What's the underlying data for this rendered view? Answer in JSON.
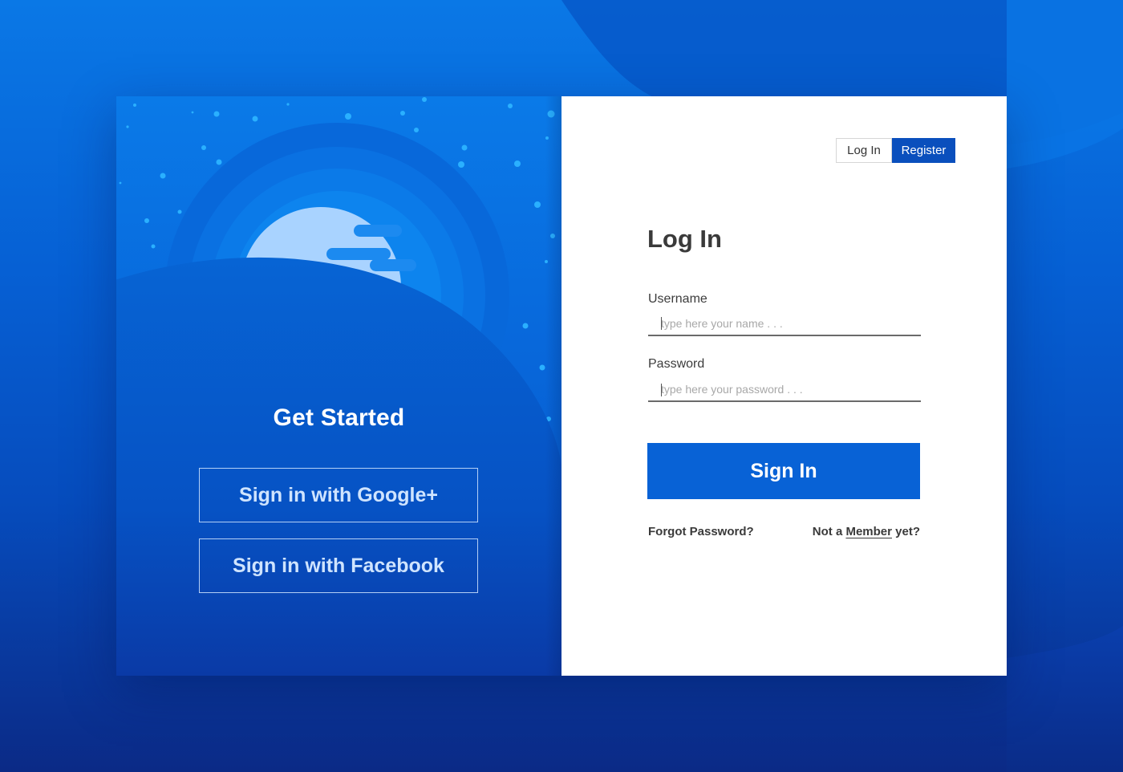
{
  "colors": {
    "brand_blue": "#0862d6",
    "tab_active": "#0a4fbd",
    "heading_text": "#3a3a3a",
    "placeholder_text": "#a8a8a8"
  },
  "left": {
    "heading": "Get Started",
    "google_label": "Sign in with Google+",
    "facebook_label": "Sign in with Facebook"
  },
  "tabs": {
    "login": "Log In",
    "register": "Register",
    "active": "Register"
  },
  "form": {
    "heading": "Log In",
    "username_label": "Username",
    "username_placeholder": "type here your name . . .",
    "username_value": "",
    "password_label": "Password",
    "password_placeholder": "type here your password . . .",
    "password_value": "",
    "submit_label": "Sign In",
    "forgot_label": "Forgot Password?",
    "not_a": "Not a",
    "member_link": "Member",
    "yet": "yet?"
  },
  "icons": {
    "illustration": "moon-planet-illustration"
  }
}
